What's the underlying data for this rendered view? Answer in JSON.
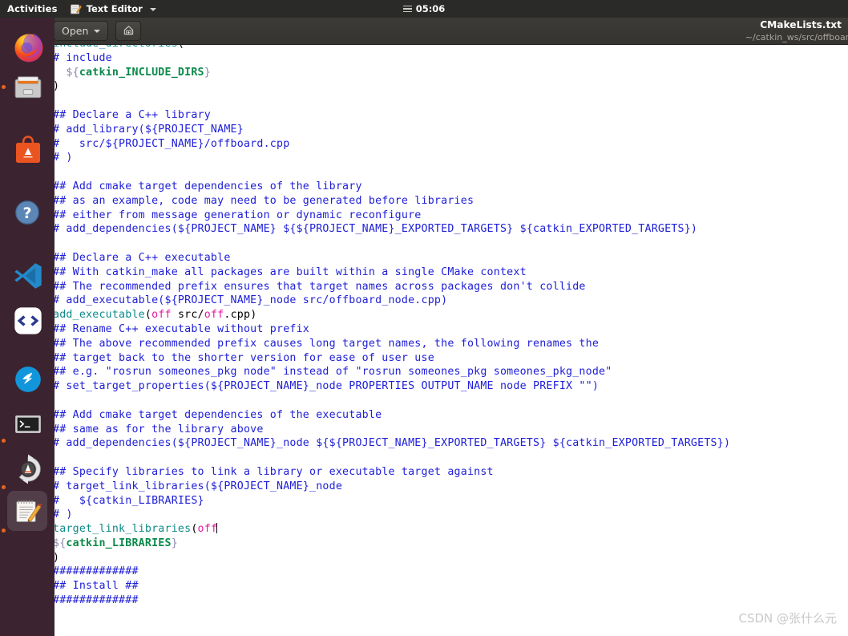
{
  "topbar": {
    "activities": "Activities",
    "app_name": "Text Editor",
    "app_icon": "text-editor-icon",
    "clock": "05:06",
    "menu_icon": "hamburger-icon"
  },
  "dock": {
    "items": [
      {
        "name": "firefox",
        "label": "Firefox",
        "icon": "firefox-icon",
        "running": false,
        "active": false
      },
      {
        "name": "files",
        "label": "Files",
        "icon": "file-manager-icon",
        "running": true,
        "active": false
      },
      {
        "name": "ubuntu-software",
        "label": "Ubuntu Software",
        "icon": "ubuntu-software-icon",
        "running": false,
        "active": false
      },
      {
        "name": "help",
        "label": "Help",
        "icon": "help-icon",
        "running": false,
        "active": false
      },
      {
        "name": "vscode",
        "label": "Visual Studio Code",
        "icon": "vscode-icon",
        "running": false,
        "active": false
      },
      {
        "name": "code-editor",
        "label": "Code",
        "icon": "code-brackets-icon",
        "running": false,
        "active": false
      },
      {
        "name": "dingtalk",
        "label": "DingTalk",
        "icon": "dingtalk-icon",
        "running": false,
        "active": false
      },
      {
        "name": "terminal",
        "label": "Terminal",
        "icon": "terminal-icon",
        "running": true,
        "active": false
      },
      {
        "name": "software-updater",
        "label": "Software Updater",
        "icon": "software-updater-icon",
        "running": true,
        "active": false
      },
      {
        "name": "text-editor",
        "label": "Text Editor",
        "icon": "text-editor-icon",
        "running": true,
        "active": true
      }
    ]
  },
  "headerbar": {
    "open_label": "Open",
    "open_icon": "chevron-down-icon",
    "save_icon": "save-icon",
    "title": "CMakeLists.txt",
    "subtitle": "~/catkin_ws/src/offboard"
  },
  "editor": {
    "language": "cmake",
    "cursor_line": "target_link_libraries(off",
    "colors": {
      "background": "#ffffff",
      "comment": "#2020d8",
      "function": "#0f8a8a",
      "variable": "#0a8a4a",
      "brace": "#8a8ab0",
      "argument": "#e619a0",
      "text": "#000000"
    },
    "lines": [
      [
        {
          "t": "include_directories",
          "c": "c-func"
        },
        {
          "t": "(",
          "c": "c-plain"
        }
      ],
      [
        {
          "t": "# include",
          "c": "c-comment"
        }
      ],
      [
        {
          "t": "  ",
          "c": "c-plain"
        },
        {
          "t": "${",
          "c": "c-brace"
        },
        {
          "t": "catkin_INCLUDE_DIRS",
          "c": "c-var"
        },
        {
          "t": "}",
          "c": "c-brace"
        }
      ],
      [
        {
          "t": ")",
          "c": "c-plain"
        }
      ],
      [],
      [
        {
          "t": "## Declare a C++ library",
          "c": "c-comment"
        }
      ],
      [
        {
          "t": "# add_library(${PROJECT_NAME}",
          "c": "c-comment"
        }
      ],
      [
        {
          "t": "#   src/${PROJECT_NAME}/offboard.cpp",
          "c": "c-comment"
        }
      ],
      [
        {
          "t": "# )",
          "c": "c-comment"
        }
      ],
      [],
      [
        {
          "t": "## Add cmake target dependencies of the library",
          "c": "c-comment"
        }
      ],
      [
        {
          "t": "## as an example, code may need to be generated before libraries",
          "c": "c-comment"
        }
      ],
      [
        {
          "t": "## either from message generation or dynamic reconfigure",
          "c": "c-comment"
        }
      ],
      [
        {
          "t": "# add_dependencies(${PROJECT_NAME} ${${PROJECT_NAME}_EXPORTED_TARGETS} ${catkin_EXPORTED_TARGETS})",
          "c": "c-comment"
        }
      ],
      [],
      [
        {
          "t": "## Declare a C++ executable",
          "c": "c-comment"
        }
      ],
      [
        {
          "t": "## With catkin_make all packages are built within a single CMake context",
          "c": "c-comment"
        }
      ],
      [
        {
          "t": "## The recommended prefix ensures that target names across packages don't collide",
          "c": "c-comment"
        }
      ],
      [
        {
          "t": "# add_executable(${PROJECT_NAME}_node src/offboard_node.cpp)",
          "c": "c-comment"
        }
      ],
      [
        {
          "t": "add_executable",
          "c": "c-func"
        },
        {
          "t": "(",
          "c": "c-plain"
        },
        {
          "t": "off",
          "c": "c-arg"
        },
        {
          "t": " src/",
          "c": "c-plain"
        },
        {
          "t": "off",
          "c": "c-arg"
        },
        {
          "t": ".cpp)",
          "c": "c-plain"
        }
      ],
      [
        {
          "t": "## Rename C++ executable without prefix",
          "c": "c-comment"
        }
      ],
      [
        {
          "t": "## The above recommended prefix causes long target names, the following renames the",
          "c": "c-comment"
        }
      ],
      [
        {
          "t": "## target back to the shorter version for ease of user use",
          "c": "c-comment"
        }
      ],
      [
        {
          "t": "## e.g. \"rosrun someones_pkg node\" instead of \"rosrun someones_pkg someones_pkg_node\"",
          "c": "c-comment"
        }
      ],
      [
        {
          "t": "# set_target_properties(${PROJECT_NAME}_node PROPERTIES OUTPUT_NAME node PREFIX \"\")",
          "c": "c-comment"
        }
      ],
      [],
      [
        {
          "t": "## Add cmake target dependencies of the executable",
          "c": "c-comment"
        }
      ],
      [
        {
          "t": "## same as for the library above",
          "c": "c-comment"
        }
      ],
      [
        {
          "t": "# add_dependencies(${PROJECT_NAME}_node ${${PROJECT_NAME}_EXPORTED_TARGETS} ${catkin_EXPORTED_TARGETS})",
          "c": "c-comment"
        }
      ],
      [],
      [
        {
          "t": "## Specify libraries to link a library or executable target against",
          "c": "c-comment"
        }
      ],
      [
        {
          "t": "# target_link_libraries(${PROJECT_NAME}_node",
          "c": "c-comment"
        }
      ],
      [
        {
          "t": "#   ${catkin_LIBRARIES}",
          "c": "c-comment"
        }
      ],
      [
        {
          "t": "# )",
          "c": "c-comment"
        }
      ],
      [
        {
          "t": "target_link_libraries",
          "c": "c-func"
        },
        {
          "t": "(",
          "c": "c-plain"
        },
        {
          "t": "off",
          "c": "c-arg"
        },
        {
          "t": "",
          "c": "cursor"
        }
      ],
      [
        {
          "t": "${",
          "c": "c-brace"
        },
        {
          "t": "catkin_LIBRARIES",
          "c": "c-var"
        },
        {
          "t": "}",
          "c": "c-brace"
        }
      ],
      [
        {
          "t": ")",
          "c": "c-plain"
        }
      ],
      [
        {
          "t": "#############",
          "c": "c-comment"
        }
      ],
      [
        {
          "t": "## Install ##",
          "c": "c-comment"
        }
      ],
      [
        {
          "t": "#############",
          "c": "c-comment"
        }
      ]
    ]
  },
  "watermark": "CSDN @张什么元"
}
